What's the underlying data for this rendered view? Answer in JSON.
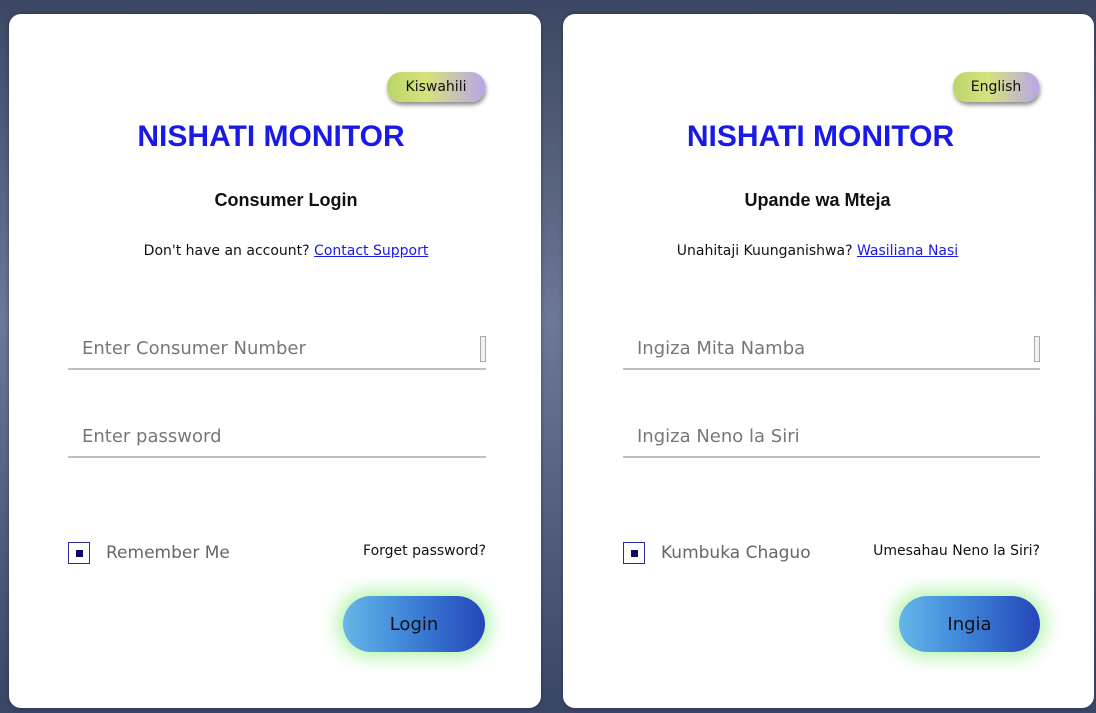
{
  "panels": [
    {
      "language_button": "Kiswahili",
      "app_title": "NISHATI MONITOR",
      "subtitle": "Consumer Login",
      "account_prompt": "Don't have an account?",
      "account_link": "Contact Support",
      "consumer_number_placeholder": "Enter Consumer Number",
      "password_placeholder": "Enter password",
      "remember_label": "Remember Me",
      "forgot_label": "Forget password?",
      "login_label": "Login"
    },
    {
      "language_button": "English",
      "app_title": "NISHATI MONITOR",
      "subtitle": "Upande wa Mteja",
      "account_prompt": "Unahitaji Kuunganishwa?",
      "account_link": "Wasiliana Nasi",
      "consumer_number_placeholder": "Ingiza Mita Namba",
      "password_placeholder": "Ingiza Neno la Siri",
      "remember_label": "Kumbuka Chaguo",
      "forgot_label": "Umesahau Neno la Siri?",
      "login_label": "Ingia"
    }
  ],
  "colors": {
    "title": "#1a1ae6",
    "link": "#1a1ae6",
    "button_gradient_start": "#65b6e8",
    "button_gradient_end": "#2546b8",
    "button_glow": "#78eb6e",
    "language_button_start": "#b9d66a",
    "language_button_end": "#b7a6ea"
  },
  "icons": {
    "checkbox": "checkbox-checked-icon",
    "field_handle": "scroll-handle-icon"
  }
}
